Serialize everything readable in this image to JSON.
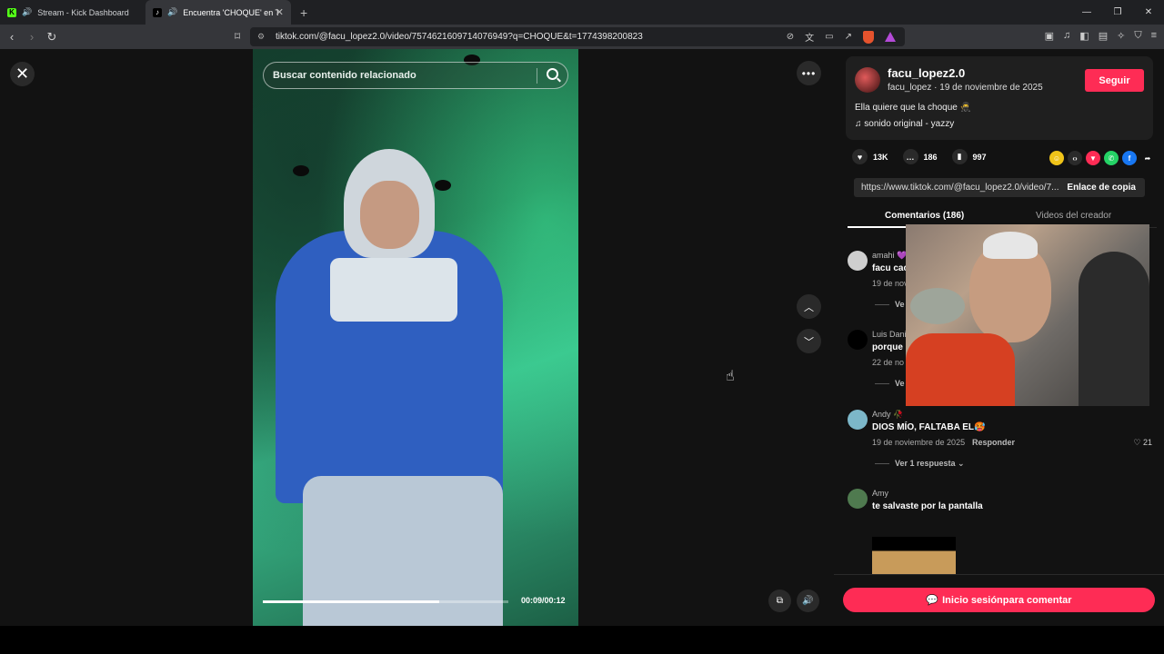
{
  "browser": {
    "tabs": [
      {
        "label": "Stream - Kick Dashboard",
        "active": false
      },
      {
        "label": "Encuentra 'CHOQUE' en TikTo",
        "active": true
      }
    ],
    "url": "tiktok.com/@facu_lopez2.0/video/7574621609714076949?q=CHOQUE&t=1774398200823"
  },
  "video": {
    "search_placeholder": "Buscar contenido relacionado",
    "time": "00:09/00:12",
    "progress": 0.72
  },
  "author": {
    "name": "facu_lopez2.0",
    "sub": "facu_lopez · 19 de noviembre de 2025",
    "follow_label": "Seguir",
    "caption": "Ella quiere que la choque 🥷",
    "sound": "sonido original - yazzy"
  },
  "stats": {
    "likes": "13K",
    "comments": "186",
    "saves": "997"
  },
  "link": {
    "url": "https://www.tiktok.com/@facu_lopez2.0/video/7...",
    "copy_label": "Enlace de copia"
  },
  "tabs": {
    "comments": "Comentarios (186)",
    "creator": "Videos del creador"
  },
  "comments": [
    {
      "user": "amahi 💜",
      "text": "facu cac",
      "date": "19 de novi",
      "more": "Ve",
      "like": "",
      "reply": ""
    },
    {
      "user": "Luis Dani",
      "text": "porque s",
      "date": "22 de no",
      "more": "Ve",
      "like": "",
      "reply": ""
    },
    {
      "user": "Andy 🥀",
      "text": "DIOS MÍO, FALTABA EL🥵",
      "date": "19 de noviembre de 2025",
      "reply": "Responder",
      "like": "♡ 21",
      "more": "Ver 1 respuesta ⌄"
    },
    {
      "user": "Amy",
      "text": "te salvaste por la pantalla",
      "date": "",
      "reply": "",
      "like": "",
      "more": ""
    }
  ],
  "login": {
    "label": "Inicio sesiónpara comentar"
  },
  "colors": {
    "accent": "#fe2c55",
    "background": "#121212"
  }
}
